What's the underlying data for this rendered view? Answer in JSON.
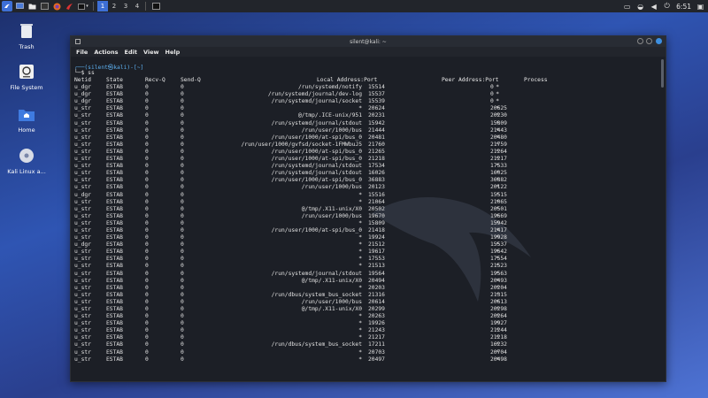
{
  "panel": {
    "workspaces": [
      "1",
      "2",
      "3",
      "4"
    ],
    "active_workspace": 0,
    "clock": "6:51"
  },
  "desktop": {
    "icons": [
      {
        "label": "Trash"
      },
      {
        "label": "File System"
      },
      {
        "label": "Home"
      },
      {
        "label": "Kali Linux a..."
      }
    ]
  },
  "terminal": {
    "title": "silent@kali: ~",
    "menu": [
      "File",
      "Actions",
      "Edit",
      "View",
      "Help"
    ],
    "prompt_line1": "┌──(silent㉿kali)-[~]",
    "prompt_line2": "└─$ ss",
    "headers": {
      "netid": "Netid",
      "state": "State",
      "recvq": "Recv-Q",
      "sendq": "Send-Q",
      "local": "Local Address:Port",
      "peer": "Peer Address:Port",
      "process": "Process"
    },
    "rows": [
      [
        "u_dgr",
        "ESTAB",
        "0",
        "0",
        "/run/systemd/notify",
        "15514",
        "*",
        "0"
      ],
      [
        "u_dgr",
        "ESTAB",
        "0",
        "0",
        "/run/systemd/journal/dev-log",
        "15537",
        "*",
        "0"
      ],
      [
        "u_dgr",
        "ESTAB",
        "0",
        "0",
        "/run/systemd/journal/socket",
        "15539",
        "*",
        "0"
      ],
      [
        "u_str",
        "ESTAB",
        "0",
        "0",
        "*",
        "20624",
        "*",
        "20625"
      ],
      [
        "u_str",
        "ESTAB",
        "0",
        "0",
        "@/tmp/.ICE-unix/951",
        "20231",
        "*",
        "20230"
      ],
      [
        "u_str",
        "ESTAB",
        "0",
        "0",
        "/run/systemd/journal/stdout",
        "15942",
        "*",
        "15809"
      ],
      [
        "u_str",
        "ESTAB",
        "0",
        "0",
        "/run/user/1000/bus",
        "21444",
        "*",
        "21443"
      ],
      [
        "u_str",
        "ESTAB",
        "0",
        "0",
        "/run/user/1000/at-spi/bus_0",
        "20481",
        "*",
        "20480"
      ],
      [
        "u_str",
        "ESTAB",
        "0",
        "0",
        "/run/user/1000/gvfsd/socket-1FMWbuJ5",
        "21760",
        "*",
        "21759"
      ],
      [
        "u_str",
        "ESTAB",
        "0",
        "0",
        "/run/user/1000/at-spi/bus_0",
        "21265",
        "*",
        "21264"
      ],
      [
        "u_str",
        "ESTAB",
        "0",
        "0",
        "/run/user/1000/at-spi/bus_0",
        "21218",
        "*",
        "21217"
      ],
      [
        "u_str",
        "ESTAB",
        "0",
        "0",
        "/run/systemd/journal/stdout",
        "17534",
        "*",
        "17533"
      ],
      [
        "u_str",
        "ESTAB",
        "0",
        "0",
        "/run/systemd/journal/stdout",
        "16026",
        "*",
        "16025"
      ],
      [
        "u_str",
        "ESTAB",
        "0",
        "0",
        "/run/user/1000/at-spi/bus_0",
        "36883",
        "*",
        "36882"
      ],
      [
        "u_str",
        "ESTAB",
        "0",
        "0",
        "/run/user/1000/bus",
        "20123",
        "*",
        "20122"
      ],
      [
        "u_dgr",
        "ESTAB",
        "0",
        "0",
        "*",
        "15516",
        "*",
        "15515"
      ],
      [
        "u_str",
        "ESTAB",
        "0",
        "0",
        "*",
        "21064",
        "*",
        "21065"
      ],
      [
        "u_str",
        "ESTAB",
        "0",
        "0",
        "@/tmp/.X11-unix/X0",
        "20502",
        "*",
        "20501"
      ],
      [
        "u_str",
        "ESTAB",
        "0",
        "0",
        "/run/user/1000/bus",
        "19670",
        "*",
        "19669"
      ],
      [
        "u_str",
        "ESTAB",
        "0",
        "0",
        "*",
        "15809",
        "*",
        "15942"
      ],
      [
        "u_str",
        "ESTAB",
        "0",
        "0",
        "/run/user/1000/at-spi/bus_0",
        "21418",
        "*",
        "21417"
      ],
      [
        "u_str",
        "ESTAB",
        "0",
        "0",
        "*",
        "19924",
        "*",
        "19928"
      ],
      [
        "u_dgr",
        "ESTAB",
        "0",
        "0",
        "*",
        "21512",
        "*",
        "15537"
      ],
      [
        "u_str",
        "ESTAB",
        "0",
        "0",
        "*",
        "19617",
        "*",
        "19642"
      ],
      [
        "u_str",
        "ESTAB",
        "0",
        "0",
        "*",
        "17553",
        "*",
        "17554"
      ],
      [
        "u_str",
        "ESTAB",
        "0",
        "0",
        "*",
        "21513",
        "*",
        "21523"
      ],
      [
        "u_str",
        "ESTAB",
        "0",
        "0",
        "/run/systemd/journal/stdout",
        "19564",
        "*",
        "19563"
      ],
      [
        "u_str",
        "ESTAB",
        "0",
        "0",
        "@/tmp/.X11-unix/X0",
        "20494",
        "*",
        "20493"
      ],
      [
        "u_str",
        "ESTAB",
        "0",
        "0",
        "*",
        "20203",
        "*",
        "20204"
      ],
      [
        "u_str",
        "ESTAB",
        "0",
        "0",
        "/run/dbus/system_bus_socket",
        "21316",
        "*",
        "21315"
      ],
      [
        "u_str",
        "ESTAB",
        "0",
        "0",
        "/run/user/1000/bus",
        "20614",
        "*",
        "20613"
      ],
      [
        "u_str",
        "ESTAB",
        "0",
        "0",
        "@/tmp/.X11-unix/X0",
        "20299",
        "*",
        "20298"
      ],
      [
        "u_str",
        "ESTAB",
        "0",
        "0",
        "*",
        "20263",
        "*",
        "20264"
      ],
      [
        "u_str",
        "ESTAB",
        "0",
        "0",
        "*",
        "19926",
        "*",
        "19927"
      ],
      [
        "u_str",
        "ESTAB",
        "0",
        "0",
        "*",
        "21243",
        "*",
        "21244"
      ],
      [
        "u_str",
        "ESTAB",
        "0",
        "0",
        "*",
        "21217",
        "*",
        "21218"
      ],
      [
        "u_str",
        "ESTAB",
        "0",
        "0",
        "/run/dbus/system_bus_socket",
        "17211",
        "*",
        "16232"
      ],
      [
        "u_str",
        "ESTAB",
        "0",
        "0",
        "*",
        "20703",
        "*",
        "20704"
      ],
      [
        "u_str",
        "ESTAB",
        "0",
        "0",
        "*",
        "20497",
        "*",
        "20498"
      ]
    ]
  },
  "colors": {
    "accent": "#3d6fd6",
    "terminal_bg": "#1c1f26",
    "prompt": "#5db0f0"
  }
}
